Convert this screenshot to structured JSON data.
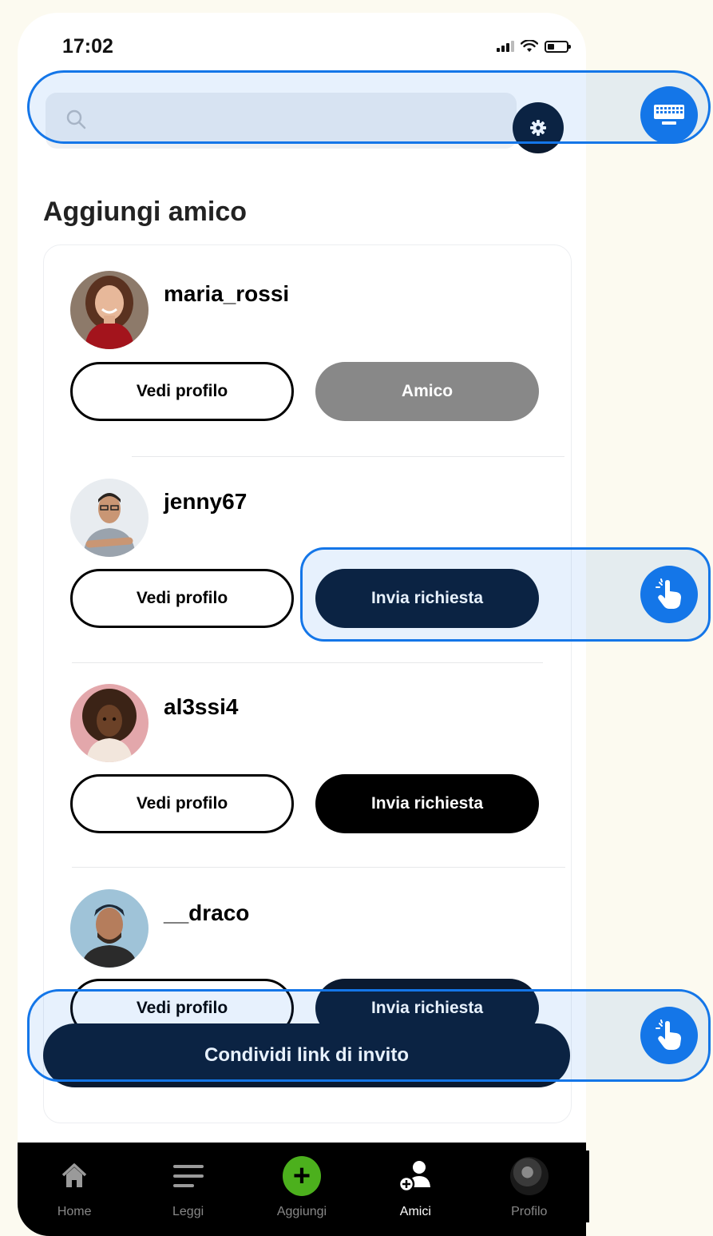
{
  "status_bar": {
    "time": "17:02"
  },
  "search": {
    "placeholder": ""
  },
  "page": {
    "title": "Aggiungi amico"
  },
  "users": [
    {
      "username": "maria_rossi",
      "view_label": "Vedi profilo",
      "action_label": "Amico"
    },
    {
      "username": "jenny67",
      "view_label": "Vedi profilo",
      "action_label": "Invia richiesta"
    },
    {
      "username": "al3ssi4",
      "view_label": "Vedi profilo",
      "action_label": "Invia richiesta"
    },
    {
      "username": "__draco",
      "view_label": "Vedi profilo",
      "action_label": "Invia richiesta"
    }
  ],
  "invite": {
    "label": "Condividi link di invito"
  },
  "tabbar": {
    "items": [
      {
        "label": "Home",
        "icon": "home-icon"
      },
      {
        "label": "Leggi",
        "icon": "menu-lines-icon"
      },
      {
        "label": "Aggiungi",
        "icon": "plus-circle-icon"
      },
      {
        "label": "Amici",
        "icon": "add-friend-icon"
      },
      {
        "label": "Profilo",
        "icon": "profile-avatar"
      }
    ],
    "active": "Amici"
  },
  "colors": {
    "accent": "#1476e8",
    "dark_button": "#0b1a30",
    "friend_button": "#888888",
    "add_green": "#4cb01d"
  }
}
